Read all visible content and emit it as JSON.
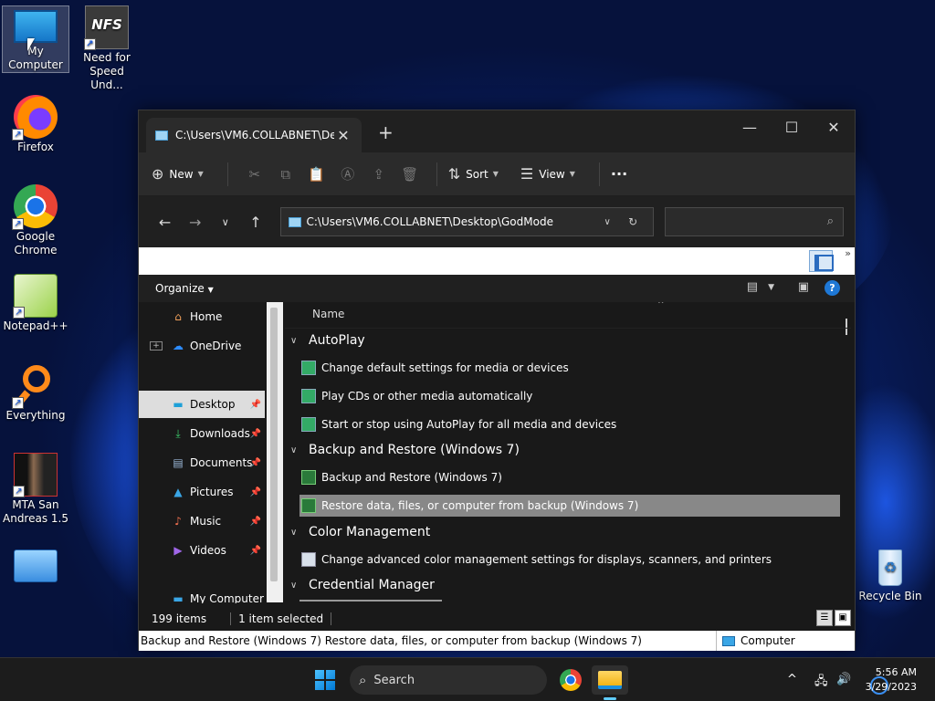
{
  "desktop": {
    "icons": [
      {
        "label": "My Computer"
      },
      {
        "label": "Need for Speed Und..."
      },
      {
        "label": "Firefox"
      },
      {
        "label": "Google Chrome"
      },
      {
        "label": "Notepad++"
      },
      {
        "label": "Everything"
      },
      {
        "label": "MTA San Andreas 1.5"
      },
      {
        "label": ""
      },
      {
        "label": "Recycle Bin"
      }
    ],
    "nfs_logo": "NFS"
  },
  "window": {
    "tab_title": "C:\\Users\\VM6.COLLABNET\\De",
    "toolbar": {
      "new": "New",
      "sort": "Sort",
      "view": "View",
      "more": "···"
    },
    "address": "C:\\Users\\VM6.COLLABNET\\Desktop\\GodMode",
    "search_placeholder": "",
    "organize": "Organize",
    "nav": [
      {
        "label": "Home"
      },
      {
        "label": "OneDrive"
      },
      {
        "label": "Desktop"
      },
      {
        "label": "Downloads"
      },
      {
        "label": "Documents"
      },
      {
        "label": "Pictures"
      },
      {
        "label": "Music"
      },
      {
        "label": "Videos"
      },
      {
        "label": "My Computer"
      }
    ],
    "column_name": "Name",
    "groups": [
      {
        "title": "AutoPlay",
        "items": [
          "Change default settings for media or devices",
          "Play CDs or other media automatically",
          "Start or stop using AutoPlay for all media and devices"
        ]
      },
      {
        "title": "Backup and Restore (Windows 7)",
        "items": [
          "Backup and Restore (Windows 7)",
          "Restore data, files, or computer from backup (Windows 7)"
        ]
      },
      {
        "title": "Color Management",
        "items": [
          "Change advanced color management settings for displays, scanners, and printers"
        ]
      },
      {
        "title": "Credential Manager",
        "items": []
      }
    ],
    "status": {
      "count": "199 items",
      "selected": "1 item selected"
    },
    "info": {
      "text": "Backup and Restore (Windows 7) Restore data, files, or computer from backup (Windows 7)",
      "zone": "Computer"
    }
  },
  "taskbar": {
    "search": "Search",
    "time": "5:56 AM",
    "date": "3/29/2023"
  }
}
